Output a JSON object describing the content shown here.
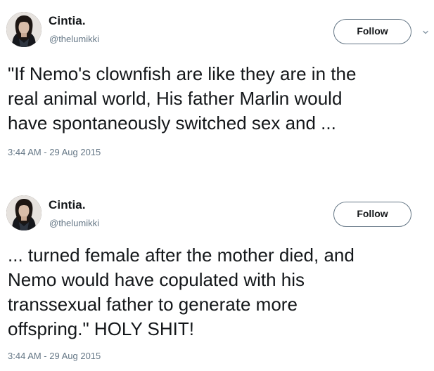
{
  "tweets": [
    {
      "display_name": "Cintia.",
      "handle": "@thelumikki",
      "follow_label": "Follow",
      "text_lines": [
        "\"If Nemo's clownfish are like they are in the",
        "real animal world, His father Marlin would",
        "have spontaneously switched sex and ..."
      ],
      "timestamp": "3:44 AM - 29 Aug 2015",
      "has_menu_caret": true
    },
    {
      "display_name": "Cintia.",
      "handle": "@thelumikki",
      "follow_label": "Follow",
      "text_lines": [
        "... turned female after the mother died, and",
        "Nemo would have copulated with his",
        "transsexual father to generate more",
        "offspring.\" HOLY SHIT!"
      ],
      "timestamp": "3:44 AM - 29 Aug 2015",
      "has_menu_caret": false
    }
  ],
  "colors": {
    "primary_text": "#14171a",
    "secondary_text": "#657786",
    "button_border": "#657786",
    "background": "#ffffff"
  },
  "icons": {
    "menu": "chevron-down-icon",
    "avatar": "profile-photo"
  }
}
